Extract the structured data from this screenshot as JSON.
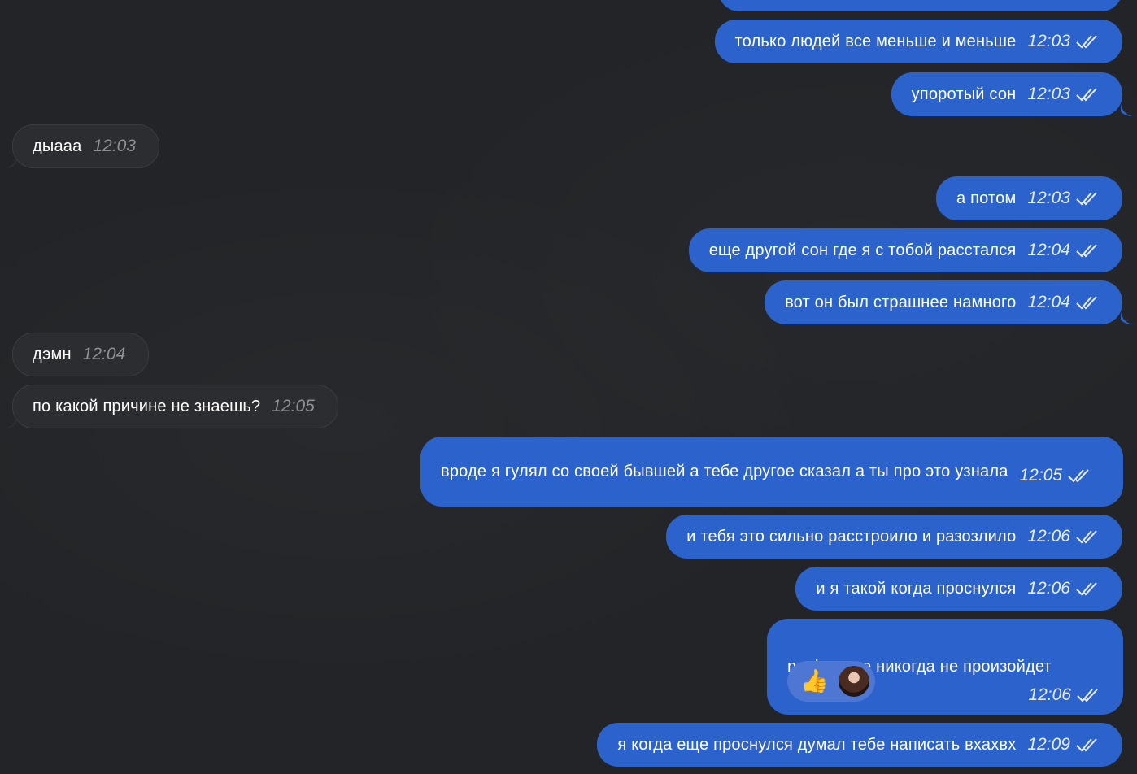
{
  "messages": [
    {
      "dir": "out",
      "text": "только людей все меньше и меньше",
      "time": "12:03"
    },
    {
      "dir": "out",
      "text": "упоротый сон",
      "time": "12:03"
    },
    {
      "dir": "in",
      "text": "дыааа",
      "time": "12:03"
    },
    {
      "dir": "out",
      "text": "а потом",
      "time": "12:03"
    },
    {
      "dir": "out",
      "text": "еще другой сон где я с тобой расстался",
      "time": "12:04"
    },
    {
      "dir": "out",
      "text": "вот он был страшнее намного",
      "time": "12:04"
    },
    {
      "dir": "in",
      "text": "дэмн",
      "time": "12:04"
    },
    {
      "dir": "in",
      "text": "по какой причине не знаешь?",
      "time": "12:05"
    },
    {
      "dir": "out",
      "text": "вроде я гулял со своей бывшей а тебе другое сказал а ты про это узнала",
      "time": "12:05"
    },
    {
      "dir": "out",
      "text": "и тебя это сильно расстроило и разозлило",
      "time": "12:06"
    },
    {
      "dir": "out",
      "text": "и я такой когда проснулся",
      "time": "12:06"
    },
    {
      "dir": "out",
      "text": "naah такое никогда не произойдет",
      "time": "12:06",
      "reactions": [
        {
          "emoji": "👍"
        },
        {
          "icon": "avatar"
        }
      ]
    },
    {
      "dir": "out",
      "text": "я когда еще проснулся думал тебе написать вхахвх",
      "time": "12:09"
    }
  ],
  "colors": {
    "background": "#222427",
    "outgoing_bubble": "#2c62cb",
    "incoming_bubble": "#2c2d30"
  },
  "icons": {
    "read_status": "double-check-icon"
  }
}
